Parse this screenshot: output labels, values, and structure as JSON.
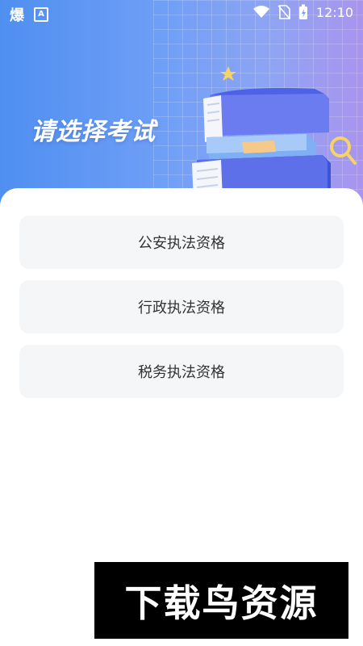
{
  "status_bar": {
    "app_glyph": "爆",
    "a_badge": "A",
    "time": "12:10",
    "icons": [
      "wifi-icon",
      "no-sim-icon",
      "battery-charging-icon"
    ]
  },
  "hero": {
    "title": "请选择考试",
    "colors": {
      "gradient_start": "#4f8ff0",
      "gradient_end": "#a994ee"
    }
  },
  "exam_list": [
    {
      "label": "公安执法资格"
    },
    {
      "label": "行政执法资格"
    },
    {
      "label": "税务执法资格"
    }
  ],
  "watermark": {
    "text": "下载鸟资源"
  }
}
